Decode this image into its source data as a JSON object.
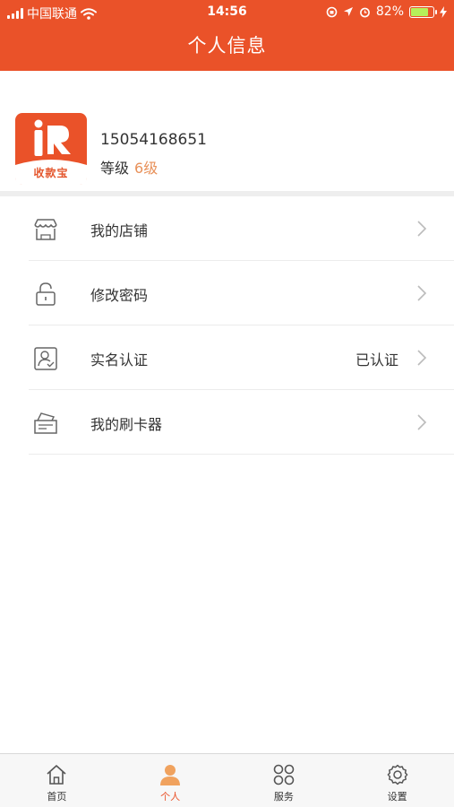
{
  "status_bar": {
    "carrier": "中国联通",
    "time": "14:56",
    "battery_percent": "82%",
    "battery_level": 0.82
  },
  "header": {
    "title": "个人信息"
  },
  "profile": {
    "logo_text": "收款宝",
    "phone": "15054168651",
    "level_label": "等级",
    "level_value": "6级"
  },
  "menu": {
    "items": [
      {
        "label": "我的店铺",
        "value": "",
        "icon": "shop-icon"
      },
      {
        "label": "修改密码",
        "value": "",
        "icon": "lock-icon"
      },
      {
        "label": "实名认证",
        "value": "已认证",
        "icon": "id-card-icon"
      },
      {
        "label": "我的刷卡器",
        "value": "",
        "icon": "card-reader-icon"
      }
    ]
  },
  "tabbar": {
    "items": [
      {
        "label": "首页",
        "icon": "home-icon",
        "active": false
      },
      {
        "label": "个人",
        "icon": "person-icon",
        "active": true
      },
      {
        "label": "服务",
        "icon": "grid-icon",
        "active": false
      },
      {
        "label": "设置",
        "icon": "gear-icon",
        "active": false
      }
    ]
  },
  "colors": {
    "brand": "#ea5229",
    "level_accent": "#e8915a",
    "battery_fill": "#b6f05a"
  }
}
